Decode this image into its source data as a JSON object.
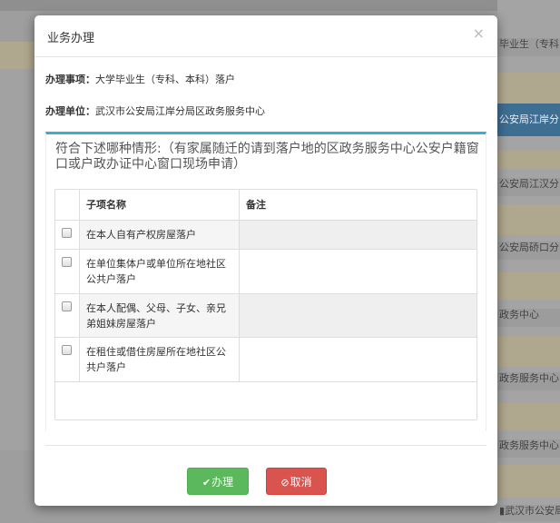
{
  "background": {
    "right_rows": [
      "毕业生（专科",
      "公安局江岸分",
      "公安局江汉分",
      "公安局硚口分",
      "政务中心",
      "政务服务中心",
      "政务服务中心",
      "武汉市公安局洪山分"
    ]
  },
  "modal": {
    "title": "业务办理",
    "close_glyph": "×",
    "item_label": "办理事项：",
    "item_value": "大学毕业生（专科、本科）落户",
    "unit_label": "办理单位：",
    "unit_value": "武汉市公安局江岸分局区政务服务中心",
    "question": "符合下述哪种情形:（有家属随迁的请到落户地的区政务服务中心公安户籍窗口或户政办证中心窗口现场申请）",
    "table": {
      "headers": [
        "子项名称",
        "备注"
      ],
      "rows": [
        {
          "name": "在本人自有产权房屋落户",
          "note": ""
        },
        {
          "name": "在单位集体户或单位所在地社区公共户落户",
          "note": ""
        },
        {
          "name": "在本人配偶、父母、子女、亲兄弟姐妹房屋落户",
          "note": ""
        },
        {
          "name": "在租住或借住房屋所在地社区公共户落户",
          "note": ""
        }
      ]
    },
    "ok_label": "办理",
    "cancel_label": "取消"
  },
  "colors": {
    "ok": "#5cb85c",
    "cancel": "#d9534f",
    "accent": "#3ab0cf"
  },
  "icons": {
    "ok": "check-icon",
    "cancel": "ban-icon",
    "bg_row": "bookmark-icon"
  }
}
